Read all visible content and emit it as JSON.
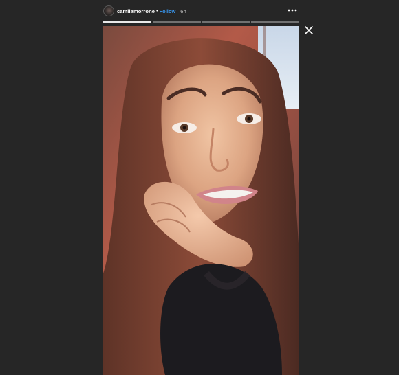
{
  "header": {
    "username": "camilamorrone",
    "separator": "•",
    "follow_label": "Follow",
    "time_ago": "6h"
  },
  "icons": {
    "more": "more-options-icon",
    "close": "close-icon",
    "avatar": "profile-avatar"
  },
  "progress": {
    "segments": 4,
    "completed": 1
  },
  "colors": {
    "background": "#262626",
    "follow": "#3897f0"
  }
}
